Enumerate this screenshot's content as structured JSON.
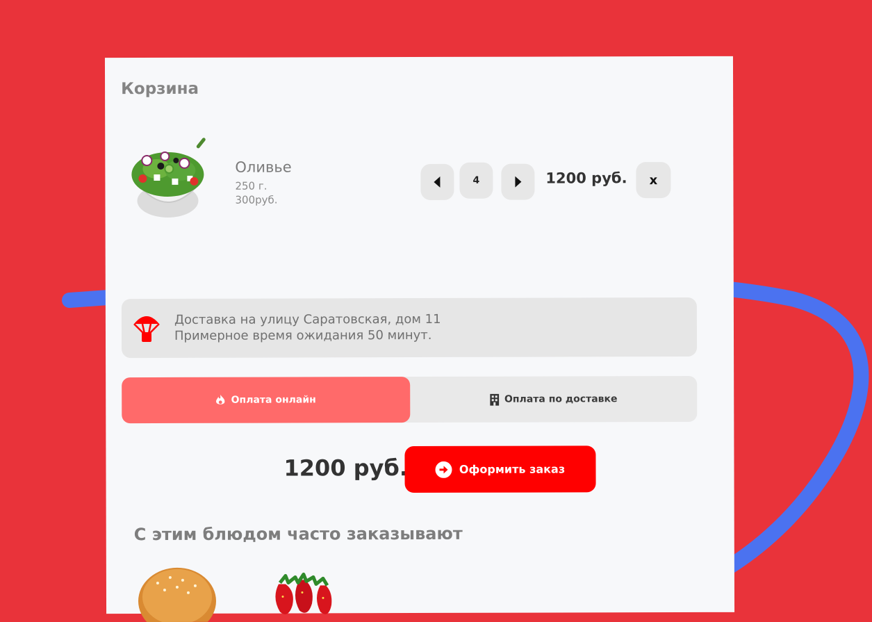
{
  "cart": {
    "title": "Корзина",
    "item": {
      "name": "Оливье",
      "weight": "250 г.",
      "unit_price": "300руб.",
      "quantity": "4",
      "line_total": "1200 руб.",
      "remove_label": "x"
    }
  },
  "delivery": {
    "line1": "Доставка на улицу Саратовская, дом 11",
    "line2": "Примерное время ожидания 50  минут."
  },
  "payment": {
    "online_label": "Оплата онлайн",
    "cash_label": "Оплата по доставке",
    "selected": "online"
  },
  "summary": {
    "total": "1200 руб.",
    "order_label": "Оформить заказ"
  },
  "recommendations": {
    "title": "С этим блюдом часто заказывают"
  },
  "colors": {
    "background": "#e9333a",
    "accent": "#ff0000",
    "selected_payment": "#ff6a6a",
    "ring": "#4b72f0"
  }
}
